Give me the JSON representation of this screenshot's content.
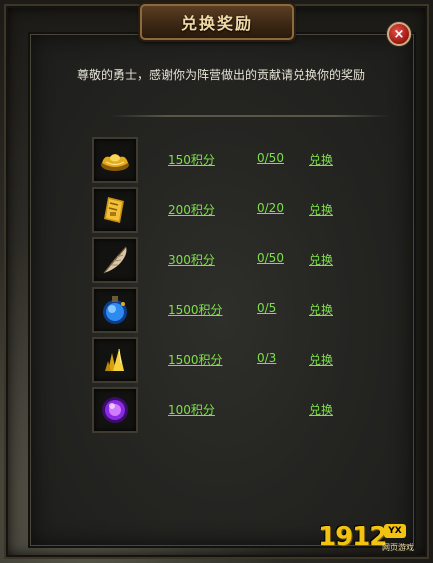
{
  "window": {
    "title": "兑换奖励",
    "close_label": "×"
  },
  "intro_text": "尊敬的勇士，感谢你为阵营做出的贡献请兑换你的奖励",
  "rewards": [
    {
      "icon": "gold-ingot-icon",
      "points": "150积分",
      "progress": "0/50",
      "exchange_label": "兑换"
    },
    {
      "icon": "gold-bar-icon",
      "points": "200积分",
      "progress": "0/20",
      "exchange_label": "兑换"
    },
    {
      "icon": "feather-icon",
      "points": "300积分",
      "progress": "0/50",
      "exchange_label": "兑换"
    },
    {
      "icon": "blue-potion-icon",
      "points": "1500积分",
      "progress": "0/5",
      "exchange_label": "兑换"
    },
    {
      "icon": "gold-crystal-icon",
      "points": "1500积分",
      "progress": "0/3",
      "exchange_label": "兑换"
    },
    {
      "icon": "purple-orb-icon",
      "points": "100积分",
      "progress": "",
      "exchange_label": "兑换"
    }
  ],
  "logo": {
    "number": "1912",
    "badge": "YX",
    "subtitle": "网页游戏"
  },
  "colors": {
    "link_green": "#7de04a",
    "title_gold": "#f1d9a6",
    "close_red": "#c0251f"
  }
}
